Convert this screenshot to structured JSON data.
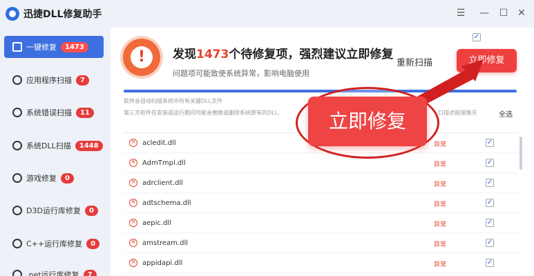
{
  "app": {
    "title": "迅捷DLL修复助手"
  },
  "window_controls": {
    "menu": "☰",
    "minimize": "—",
    "maximize": "☐",
    "close": "✕"
  },
  "sidebar": {
    "items": [
      {
        "label": "一键修复",
        "badge": "1473",
        "icon": "one-click-repair-icon",
        "active": true
      },
      {
        "label": "应用程序扫描",
        "badge": "7",
        "icon": "app-scan-icon"
      },
      {
        "label": "系统错误扫描",
        "badge": "11",
        "icon": "system-error-icon"
      },
      {
        "label": "系统DLL扫描",
        "badge": "1448",
        "icon": "system-dll-icon"
      },
      {
        "label": "游戏修复",
        "badge": "0",
        "icon": "game-icon"
      },
      {
        "label": "D3D运行库修复",
        "badge": "0",
        "icon": "d3d-icon"
      },
      {
        "label": "C++运行库修复",
        "badge": "0",
        "icon": "cpp-icon"
      },
      {
        "label": ".net运行库修复",
        "badge": "7",
        "icon": "dotnet-icon"
      }
    ]
  },
  "main": {
    "headline_prefix": "发现",
    "headline_count": "1473",
    "headline_suffix": "个待修复项，强烈建议立即修复",
    "subline": "问题项可能致使系统异常，影响电脑使用",
    "rescan_label": "重新扫描",
    "fix_label": "立即修复",
    "progress": 1.0,
    "info_line1": "软件会自动扫描系统中所有关键DLL文件",
    "info_line2": "第三方软件在安装或运行期间可能会替换或删除系统原有的DLL,",
    "info_line2_tail": "口描述报错情况",
    "select_all_label": "全选",
    "select_all_check": "✓"
  },
  "dll_list": {
    "rows": [
      {
        "name": "acledit.dll",
        "status": "异常",
        "checked": "✓"
      },
      {
        "name": "AdmTmpl.dll",
        "status": "异常",
        "checked": "✓"
      },
      {
        "name": "adrclient.dll",
        "status": "异常",
        "checked": "✓"
      },
      {
        "name": "adtschema.dll",
        "status": "异常",
        "checked": "✓"
      },
      {
        "name": "aepic.dll",
        "status": "异常",
        "checked": "✓"
      },
      {
        "name": "amstream.dll",
        "status": "异常",
        "checked": "✓"
      },
      {
        "name": "appidapi.dll",
        "status": "异常",
        "checked": "✓"
      }
    ]
  },
  "overlay": {
    "big_fix_label": "立即修复"
  },
  "colors": {
    "accent": "#3d6fe0",
    "danger": "#ef4040",
    "annotation": "#d02020"
  }
}
